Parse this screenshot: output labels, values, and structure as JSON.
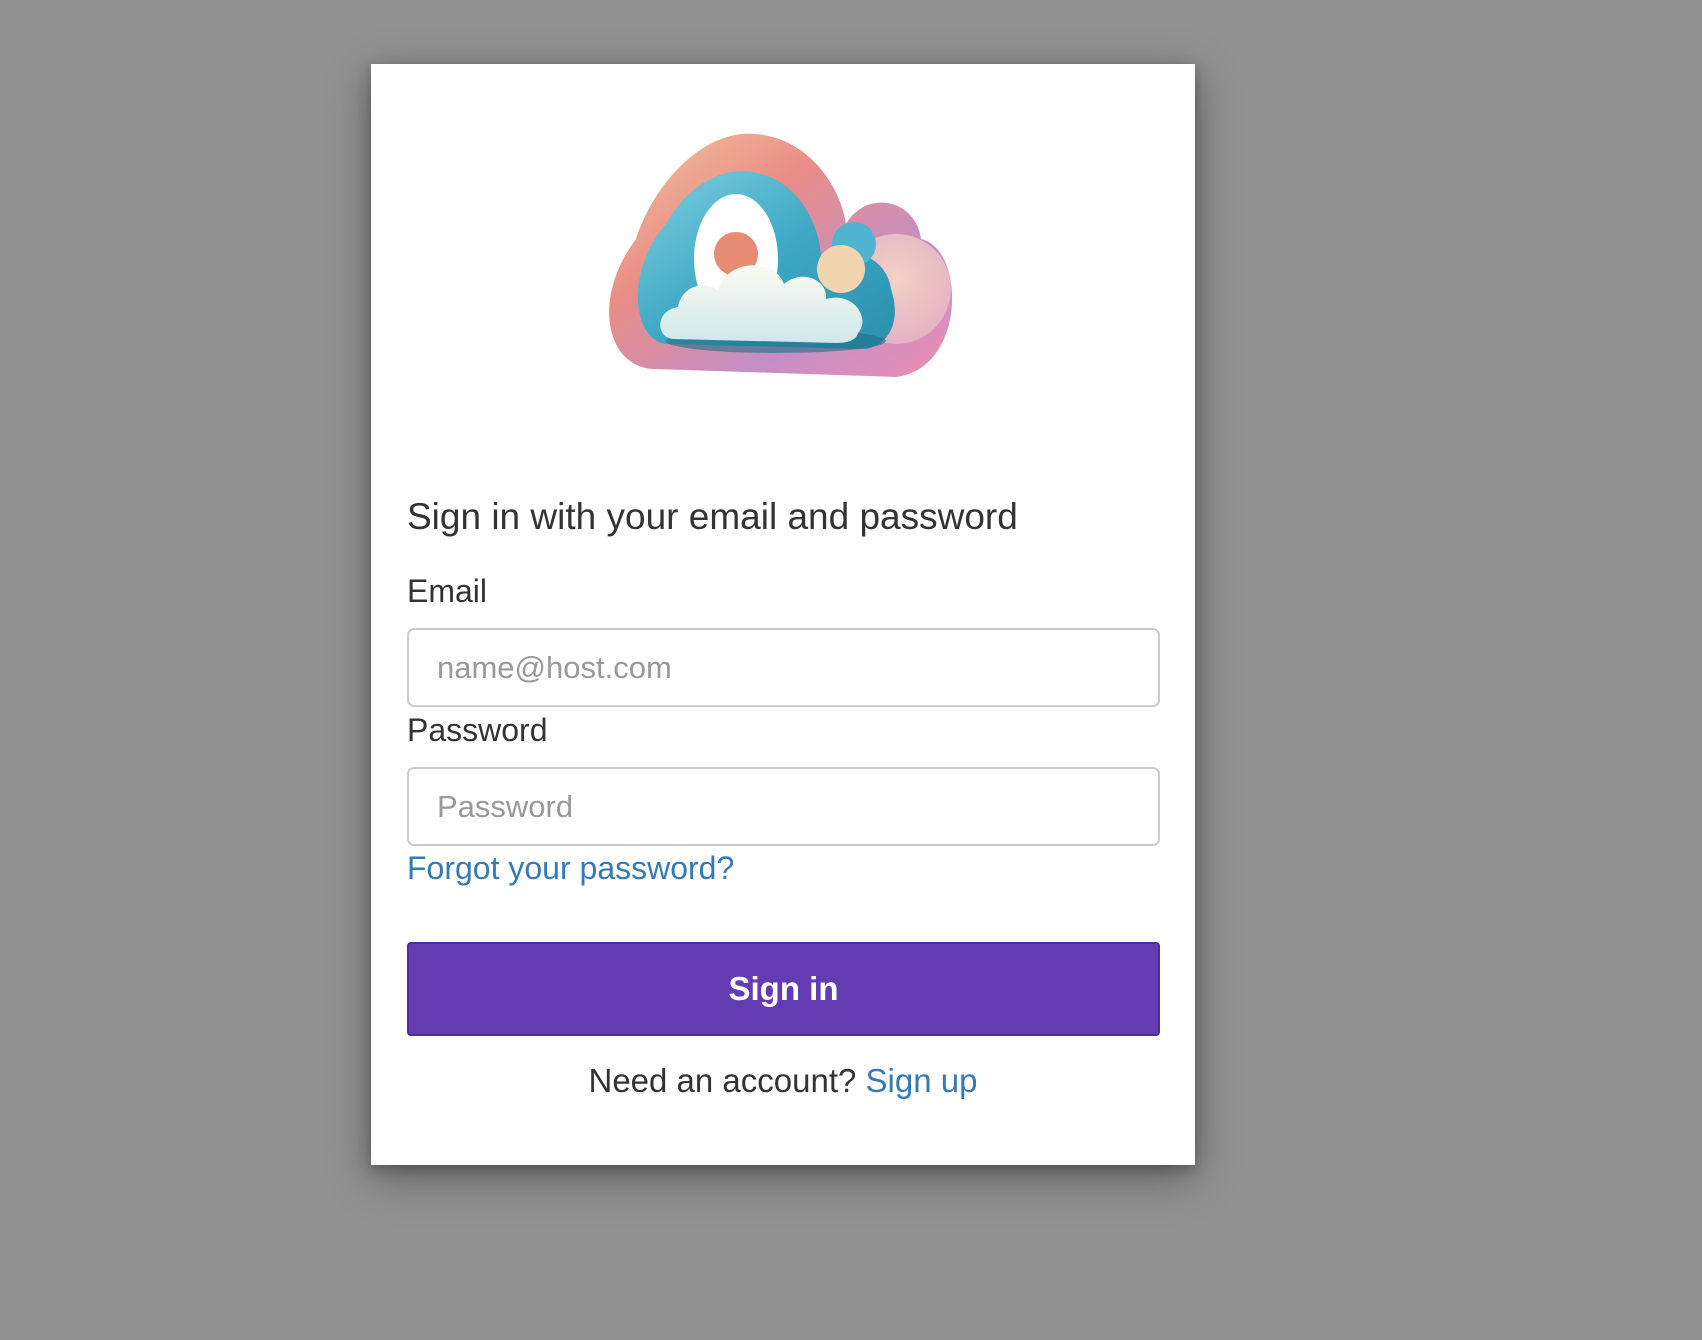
{
  "logo": {
    "icon": "cloud-logo-icon"
  },
  "form": {
    "heading": "Sign in with your email and password",
    "email_label": "Email",
    "email_placeholder": "name@host.com",
    "email_value": "",
    "password_label": "Password",
    "password_placeholder": "Password",
    "password_value": "",
    "forgot_link": "Forgot your password?",
    "submit_label": "Sign in",
    "signup_prompt": "Need an account?",
    "signup_link": "Sign up"
  },
  "colors": {
    "background": "#919191",
    "card": "#ffffff",
    "primary_button": "#633bb3",
    "link": "#337ab7",
    "text": "#333333"
  }
}
